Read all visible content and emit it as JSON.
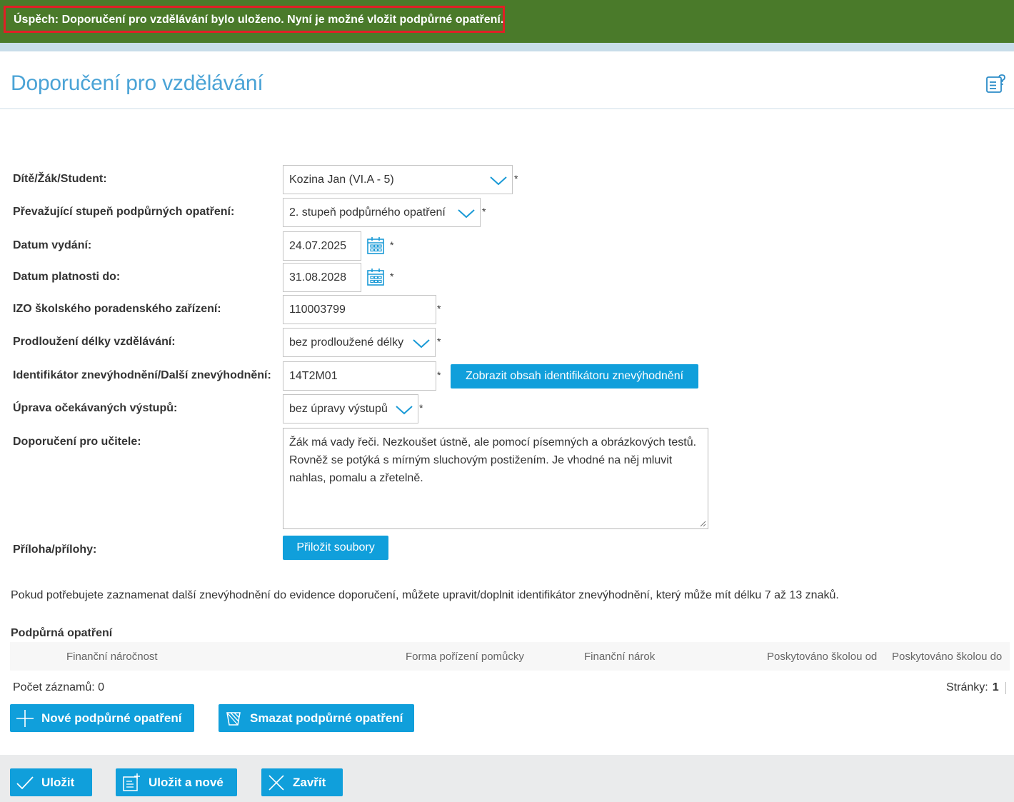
{
  "banner": {
    "message": "Úspěch:  Doporučení pro vzdělávání bylo uloženo. Nyní je možné vložit podpůrné opatření.",
    "background_color": "#4a7a2a",
    "highlight_color": "#e01f26"
  },
  "page": {
    "title": "Doporučení pro vzdělávání",
    "help_icon": "help-document-icon"
  },
  "form": {
    "student_label": "Dítě/Žák/Student:",
    "student_value": "Kozina Jan (VI.A - 5)",
    "support_level_label": "Převažující stupeň podpůrných opatření:",
    "support_level_value": "2. stupeň podpůrného opatření",
    "issue_date_label": "Datum vydání:",
    "issue_date_value": "24.07.2025",
    "valid_until_label": "Datum platnosti do:",
    "valid_until_value": "31.08.2028",
    "izo_label": "IZO školského poradenského zařízení:",
    "izo_value": "110003799",
    "extension_label": "Prodloužení délky vzdělávání:",
    "extension_value": "bez prodloužené délky",
    "disadvantage_label": "Identifikátor znevýhodnění/Další znevýhodnění:",
    "disadvantage_value": "14T2M01",
    "show_disadvantage_button": "Zobrazit obsah identifikátoru znevýhodnění",
    "outputs_label": "Úprava očekávaných výstupů:",
    "outputs_value": "bez úpravy výstupů",
    "teacher_label": "Doporučení pro učitele:",
    "teacher_value": "Žák má vady řeči. Nezkoušet ústně, ale pomocí písemných a obrázkových testů. Rovněž se potýká s mírným sluchovým postižením. Je vhodné na něj mluvit nahlas, pomalu a zřetelně.",
    "attachments_label": "Příloha/přílohy:",
    "attach_button": "Přiložit soubory",
    "required_mark": "*"
  },
  "info_text": "Pokud potřebujete zaznamenat další znevýhodnění do evidence doporučení, můžete upravit/doplnit identifikátor znevýhodnění, který může mít délku 7 až 13 znaků.",
  "measures": {
    "title": "Podpůrná opatření",
    "columns": [
      "Finanční náročnost",
      "Forma pořízení pomůcky",
      "Finanční nárok",
      "Poskytováno školou od",
      "Poskytováno školou do"
    ],
    "count_text": "Počet záznamů: 0",
    "pages_label": "Stránky:",
    "current_page": "1",
    "new_button": "Nové podpůrné opatření",
    "delete_button": "Smazat podpůrné opatření"
  },
  "footer": {
    "save_button": "Uložit",
    "save_new_button": "Uložit a nové",
    "close_button": "Zavřít"
  },
  "colors": {
    "accent": "#109fdb",
    "title": "#4aa3d6"
  }
}
